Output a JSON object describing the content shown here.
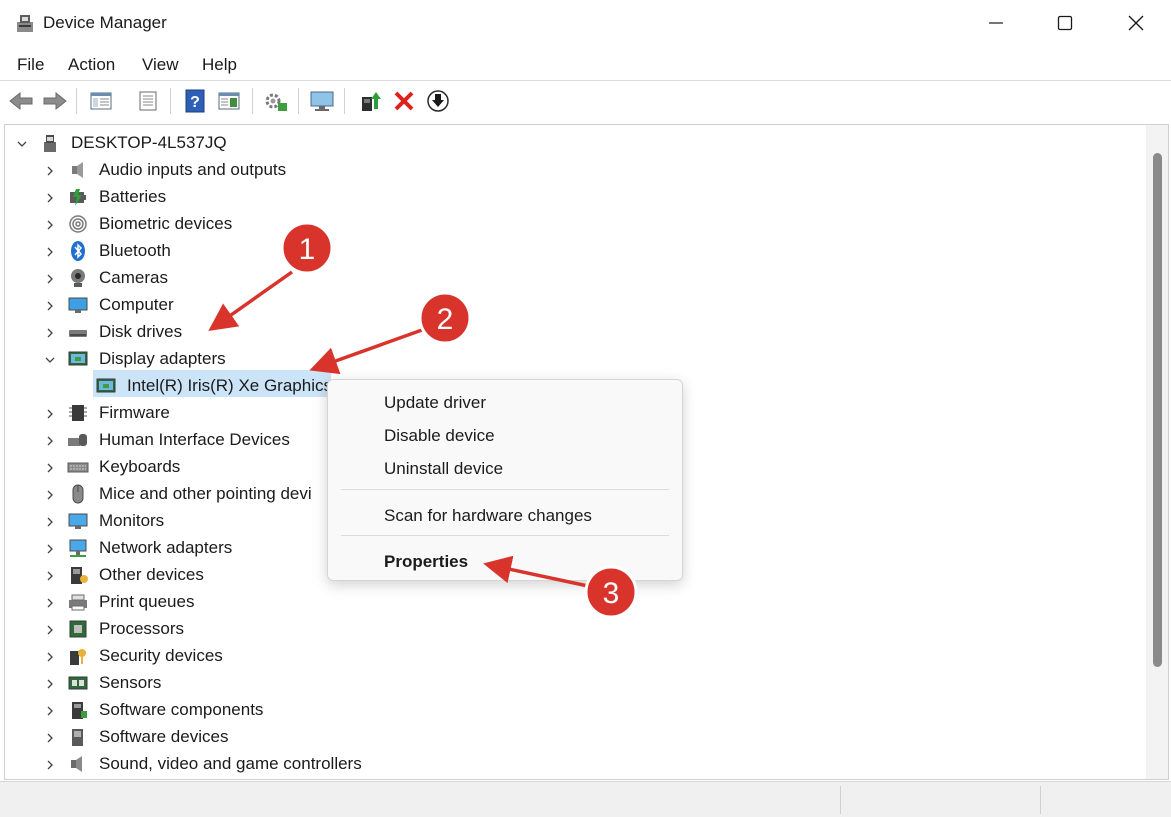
{
  "window": {
    "title": "Device Manager",
    "minimize_icon": "minimize-icon",
    "maximize_icon": "maximize-icon",
    "close_icon": "close-icon"
  },
  "menu": [
    "File",
    "Action",
    "View",
    "Help"
  ],
  "toolbar": {
    "buttons": [
      "back-icon",
      "forward-icon",
      "properties-view-icon",
      "list-view-icon",
      "help-icon",
      "details-view-icon",
      "scan-hardware-icon",
      "monitor-icon",
      "update-driver-icon",
      "uninstall-icon",
      "download-icon"
    ]
  },
  "tree": {
    "root": "DESKTOP-4L537JQ",
    "categories": [
      {
        "label": "Audio inputs and outputs",
        "icon": "speaker-icon"
      },
      {
        "label": "Batteries",
        "icon": "battery-icon"
      },
      {
        "label": "Biometric devices",
        "icon": "fingerprint-icon"
      },
      {
        "label": "Bluetooth",
        "icon": "bluetooth-icon"
      },
      {
        "label": "Cameras",
        "icon": "camera-icon"
      },
      {
        "label": "Computer",
        "icon": "computer-icon"
      },
      {
        "label": "Disk drives",
        "icon": "disk-drive-icon"
      },
      {
        "label": "Display adapters",
        "icon": "display-adapter-icon",
        "expanded": true
      },
      {
        "label": "Firmware",
        "icon": "firmware-icon"
      },
      {
        "label": "Human Interface Devices",
        "icon": "hid-icon"
      },
      {
        "label": "Keyboards",
        "icon": "keyboard-icon"
      },
      {
        "label": "Mice and other pointing devi",
        "icon": "mouse-icon"
      },
      {
        "label": "Monitors",
        "icon": "monitor-icon"
      },
      {
        "label": "Network adapters",
        "icon": "network-icon"
      },
      {
        "label": "Other devices",
        "icon": "other-device-icon"
      },
      {
        "label": "Print queues",
        "icon": "printer-icon"
      },
      {
        "label": "Processors",
        "icon": "processor-icon"
      },
      {
        "label": "Security devices",
        "icon": "security-icon"
      },
      {
        "label": "Sensors",
        "icon": "sensor-icon"
      },
      {
        "label": "Software components",
        "icon": "software-component-icon"
      },
      {
        "label": "Software devices",
        "icon": "software-device-icon"
      },
      {
        "label": "Sound, video and game controllers",
        "icon": "sound-icon"
      }
    ],
    "display_child": "Intel(R) Iris(R) Xe Graphics"
  },
  "context_menu": {
    "items": [
      "Update driver",
      "Disable device",
      "Uninstall device",
      "Scan for hardware changes",
      "Properties"
    ]
  },
  "annotations": {
    "badges": [
      "1",
      "2",
      "3"
    ],
    "color": "#d9342b"
  }
}
